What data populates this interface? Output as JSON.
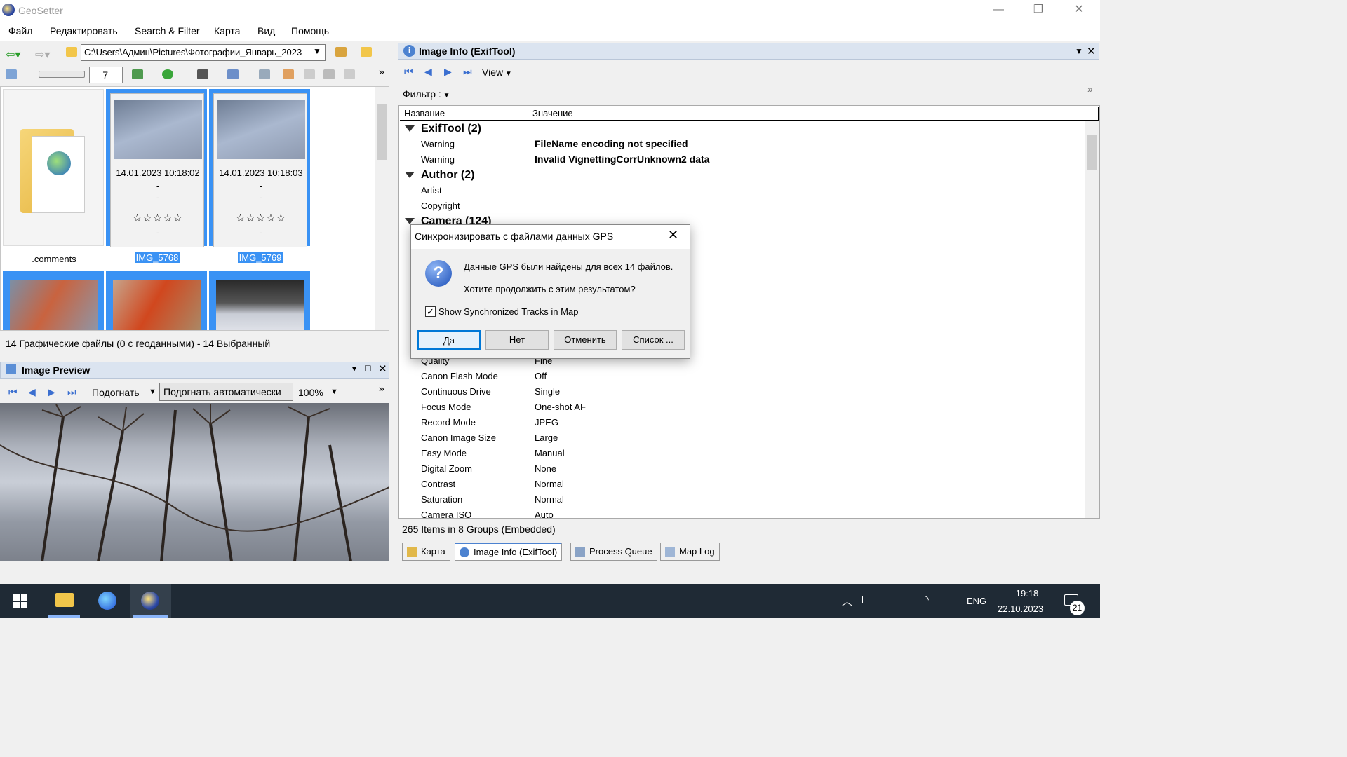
{
  "window": {
    "title": "GeoSetter",
    "minimize": "—",
    "restore": "❐",
    "close": "✕"
  },
  "menu": [
    "Файл",
    "Редактировать",
    "Search & Filter",
    "Карта",
    "Вид",
    "Помощь"
  ],
  "toolbar": {
    "address": "C:\\Users\\Админ\\Pictures\\Фотографии_Январь_2023",
    "zoom_value": "7"
  },
  "thumbnails": [
    {
      "name": ".comments",
      "type": "folder"
    },
    {
      "name": "IMG_5768",
      "date": "14.01.2023 10:18:02",
      "line2": "-",
      "line3": "-",
      "stars": "☆☆☆☆☆",
      "line5": "-"
    },
    {
      "name": "IMG_5769",
      "date": "14.01.2023 10:18:03",
      "line2": "-",
      "line3": "-",
      "stars": "☆☆☆☆☆",
      "line5": "-"
    }
  ],
  "file_status": "14 Графические файлы   (0 с геоданными)  - 14 Выбранный",
  "preview": {
    "title": "Image Preview",
    "fit": "Подогнать",
    "fit_auto": "Подогнать автоматически",
    "zoom": "100%"
  },
  "info_panel": {
    "title": "Image Info (ExifTool)",
    "view": "View",
    "filter": "Фильтр :",
    "col_name": "Название",
    "col_value": "Значение",
    "groups": [
      {
        "name": "ExifTool (2)",
        "rows": [
          {
            "n": "Warning",
            "v": "FileName encoding not specified"
          },
          {
            "n": "Warning",
            "v": "Invalid VignettingCorrUnknown2 data"
          }
        ]
      },
      {
        "name": "Author (2)",
        "rows": [
          {
            "n": "Artist",
            "v": ""
          },
          {
            "n": "Copyright",
            "v": ""
          }
        ]
      },
      {
        "name": "Camera (124)",
        "rows": [
          {
            "n": "Quality",
            "v": "Fine"
          },
          {
            "n": "Canon Flash Mode",
            "v": "Off"
          },
          {
            "n": "Continuous Drive",
            "v": "Single"
          },
          {
            "n": "Focus Mode",
            "v": "One-shot AF"
          },
          {
            "n": "Record Mode",
            "v": "JPEG"
          },
          {
            "n": "Canon Image Size",
            "v": "Large"
          },
          {
            "n": "Easy Mode",
            "v": "Manual"
          },
          {
            "n": "Digital Zoom",
            "v": "None"
          },
          {
            "n": "Contrast",
            "v": "Normal"
          },
          {
            "n": "Saturation",
            "v": "Normal"
          },
          {
            "n": "Camera ISO",
            "v": "Auto"
          }
        ]
      }
    ],
    "status": "265 Items in 8 Groups    (Embedded)"
  },
  "tabs": [
    "Карта",
    "Image Info (ExifTool)",
    "Process Queue",
    "Map Log"
  ],
  "dialog": {
    "title": "Синхронизировать с файлами данных GPS",
    "line1": "Данные GPS были найдены для всех 14 файлов.",
    "line2": "Хотите продолжить с этим результатом?",
    "checkbox": "Show Synchronized Tracks in Map",
    "checked": true,
    "buttons": [
      "Да",
      "Нет",
      "Отменить",
      "Список ..."
    ]
  },
  "taskbar": {
    "lang": "ENG",
    "time": "19:18",
    "date": "22.10.2023",
    "notifications": "21"
  }
}
